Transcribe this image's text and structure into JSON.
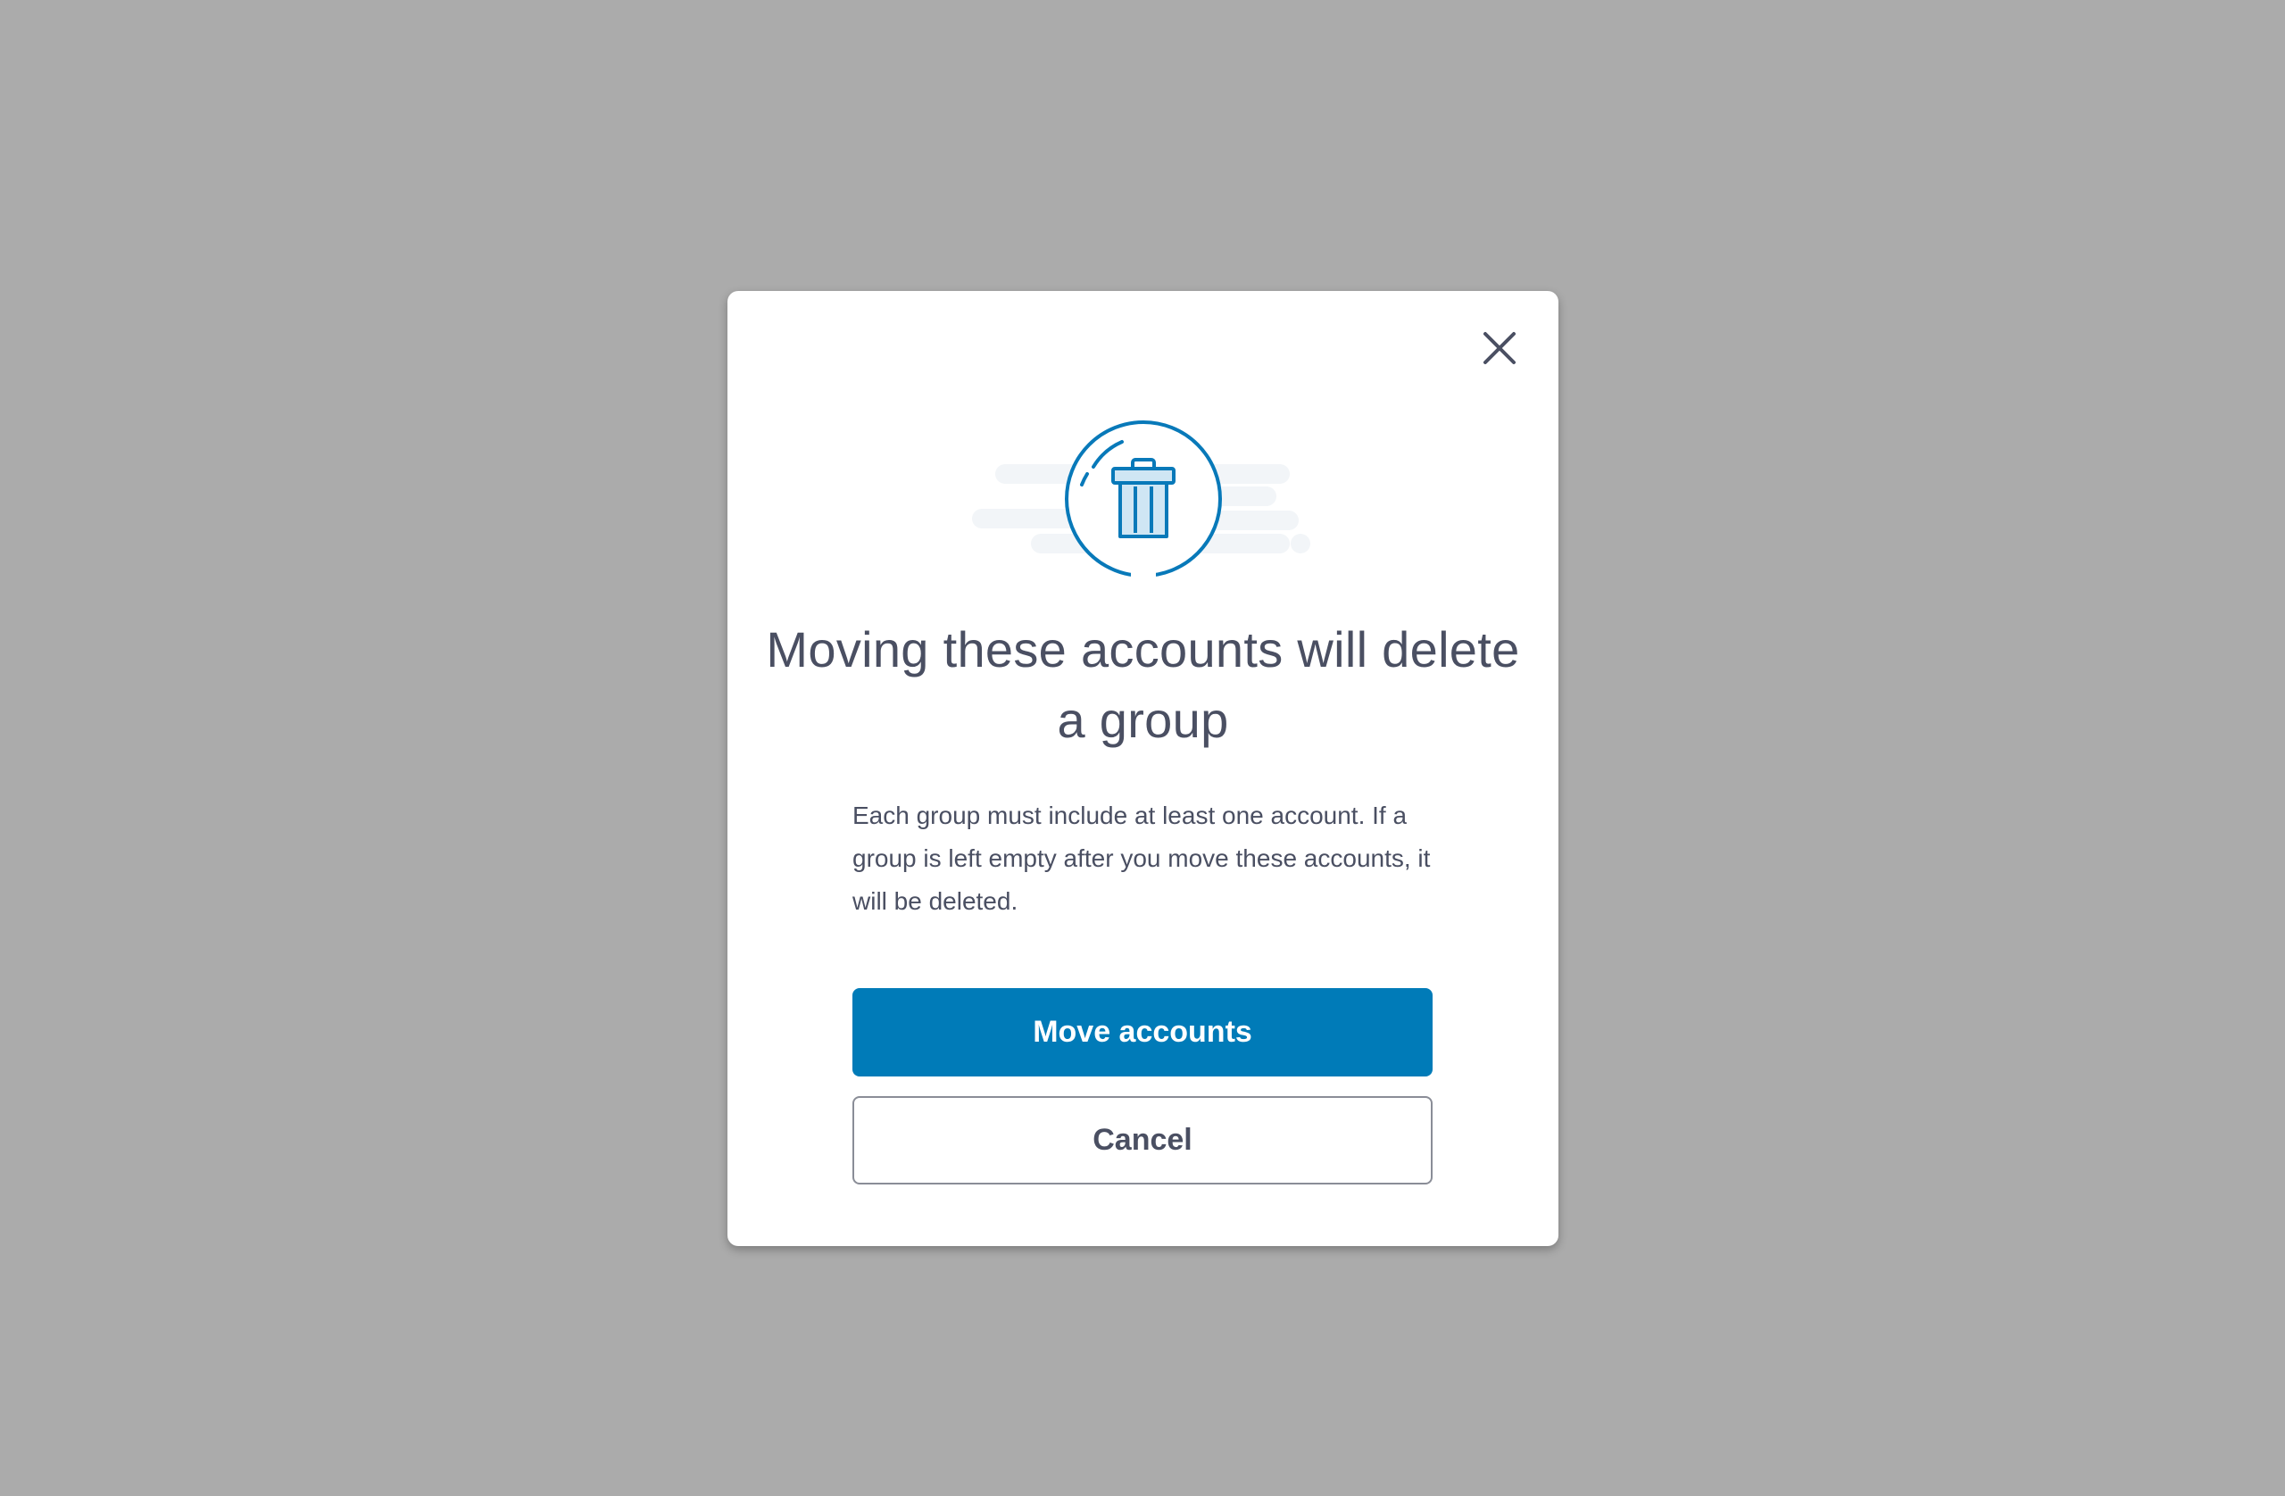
{
  "dialog": {
    "title": "Moving these accounts will delete a group",
    "message": "Each group must include at least one account. If a group is left empty after you move these accounts, it will be deleted.",
    "primary_label": "Move accounts",
    "secondary_label": "Cancel",
    "close_icon": "close-icon",
    "illustration_icon": "trash-can-icon"
  },
  "colors": {
    "backdrop": "#ababab",
    "accent": "#007bb8",
    "text": "#4a4f62",
    "illustration_fill": "#cfe6f4",
    "cloud": "#f2f5f8"
  }
}
